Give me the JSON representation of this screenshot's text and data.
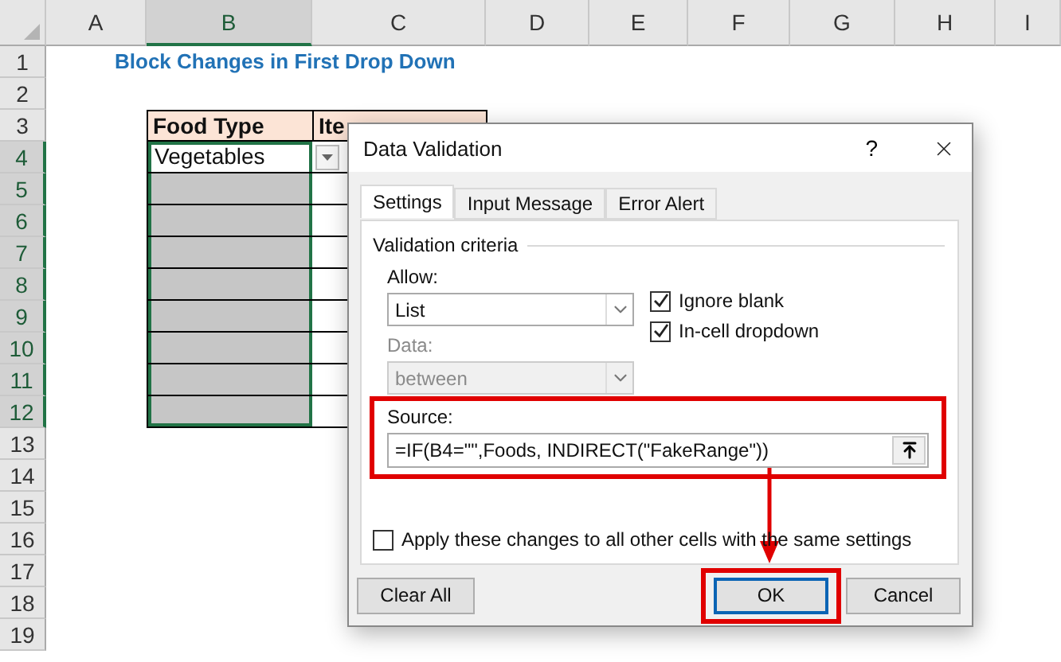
{
  "sheet": {
    "columns": [
      {
        "label": "A",
        "selected": false
      },
      {
        "label": "B",
        "selected": true
      },
      {
        "label": "C",
        "selected": false
      },
      {
        "label": "D",
        "selected": false
      },
      {
        "label": "E",
        "selected": false
      },
      {
        "label": "F",
        "selected": false
      },
      {
        "label": "G",
        "selected": false
      },
      {
        "label": "H",
        "selected": false
      },
      {
        "label": "I",
        "selected": false
      }
    ],
    "rows": [
      {
        "label": "1",
        "selected": false
      },
      {
        "label": "2",
        "selected": false
      },
      {
        "label": "3",
        "selected": false
      },
      {
        "label": "4",
        "selected": true
      },
      {
        "label": "5",
        "selected": true
      },
      {
        "label": "6",
        "selected": true
      },
      {
        "label": "7",
        "selected": true
      },
      {
        "label": "8",
        "selected": true
      },
      {
        "label": "9",
        "selected": true
      },
      {
        "label": "10",
        "selected": true
      },
      {
        "label": "11",
        "selected": true
      },
      {
        "label": "12",
        "selected": true
      },
      {
        "label": "13",
        "selected": false
      },
      {
        "label": "14",
        "selected": false
      },
      {
        "label": "15",
        "selected": false
      },
      {
        "label": "16",
        "selected": false
      },
      {
        "label": "17",
        "selected": false
      },
      {
        "label": "18",
        "selected": false
      },
      {
        "label": "19",
        "selected": false
      }
    ]
  },
  "title": "Block Changes in First Drop Down",
  "table": {
    "headers": [
      "Food Type",
      "Ite"
    ],
    "rows": [
      {
        "value": "Vegetables",
        "shaded": false,
        "selected": true,
        "dropdown": true
      },
      {
        "shaded": true,
        "selected": true
      },
      {
        "shaded": true,
        "selected": true
      },
      {
        "shaded": true,
        "selected": true
      },
      {
        "shaded": true,
        "selected": true
      },
      {
        "shaded": true,
        "selected": true
      },
      {
        "shaded": true,
        "selected": true
      },
      {
        "shaded": true,
        "selected": true
      },
      {
        "shaded": true,
        "selected": true
      }
    ]
  },
  "dialog": {
    "title": "Data Validation",
    "help": "?",
    "tabs": [
      {
        "label": "Settings",
        "selected": true
      },
      {
        "label": "Input Message",
        "selected": false
      },
      {
        "label": "Error Alert",
        "selected": false
      }
    ],
    "section": "Validation criteria",
    "allow": {
      "label": "Allow:",
      "value": "List",
      "disabled": false
    },
    "data": {
      "label": "Data:",
      "value": "between",
      "disabled": true
    },
    "options": [
      {
        "label": "Ignore blank",
        "checked": true
      },
      {
        "label": "In-cell dropdown",
        "checked": true
      }
    ],
    "source": {
      "label": "Source:",
      "value": "=IF(B4=\"\",Foods, INDIRECT(\"FakeRange\"))",
      "highlighted": true
    },
    "apply": {
      "label": "Apply these changes to all other cells with the same settings",
      "checked": false
    },
    "buttons": [
      {
        "label": "Clear All",
        "default": false,
        "highlighted": false
      },
      {
        "label": "OK",
        "default": true,
        "highlighted": true
      },
      {
        "label": "Cancel",
        "default": false,
        "highlighted": false
      }
    ]
  },
  "annotation": {
    "arrow": true
  }
}
